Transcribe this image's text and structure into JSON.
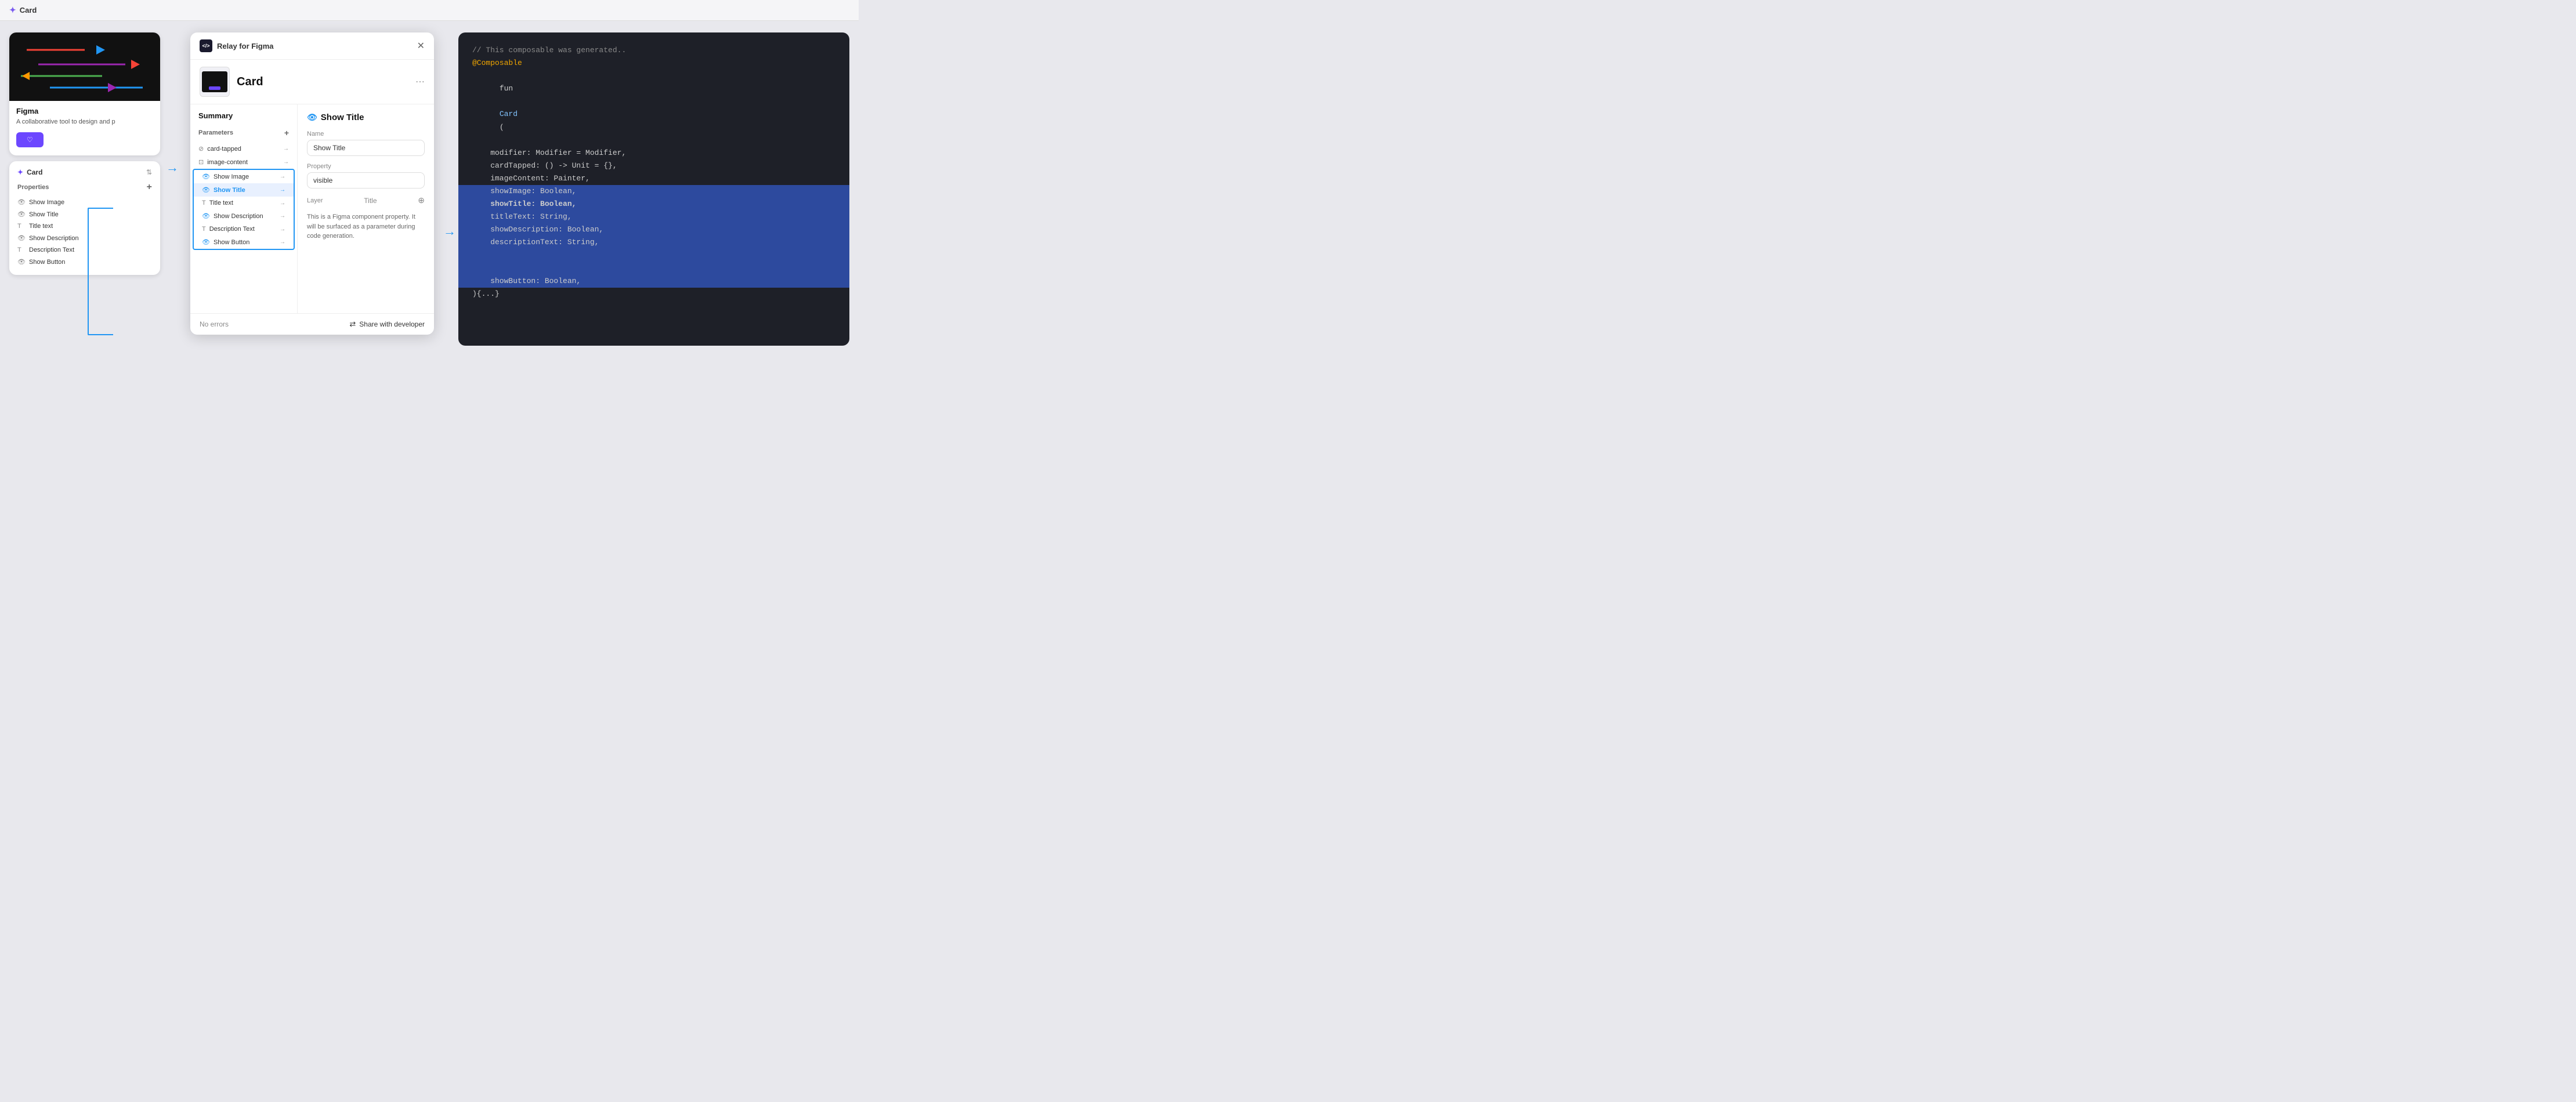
{
  "app": {
    "title": "Card",
    "logo_symbol": "✦"
  },
  "top_bar": {
    "title": "Card"
  },
  "left_panel": {
    "figma_source": "Figma",
    "figma_desc": "A collaborative tool to design and p",
    "panel_title": "Card",
    "properties_label": "Properties",
    "props": [
      {
        "icon": "eye",
        "label": "Show Image"
      },
      {
        "icon": "eye",
        "label": "Show Title"
      },
      {
        "icon": "text",
        "label": "Title text"
      },
      {
        "icon": "eye",
        "label": "Show Description"
      },
      {
        "icon": "text",
        "label": "Description Text"
      },
      {
        "icon": "eye",
        "label": "Show Button"
      }
    ]
  },
  "modal": {
    "plugin_name": "Relay for Figma",
    "component_name": "Card",
    "summary_title": "Summary",
    "params_label": "Parameters",
    "params": [
      {
        "icon": "link",
        "label": "card-tapped",
        "selected": false
      },
      {
        "icon": "image",
        "label": "image-content",
        "selected": false
      },
      {
        "icon": "eye",
        "label": "Show Image",
        "selected": false
      },
      {
        "icon": "eye",
        "label": "Show Title",
        "selected": true
      },
      {
        "icon": "text",
        "label": "Title text",
        "selected": false
      },
      {
        "icon": "eye",
        "label": "Show Description",
        "selected": false
      },
      {
        "icon": "text",
        "label": "Description Text",
        "selected": false
      },
      {
        "icon": "eye",
        "label": "Show Button",
        "selected": false
      }
    ],
    "detail": {
      "title": "Show Title",
      "name_label": "Name",
      "name_value": "Show Title",
      "property_label": "Property",
      "property_value": "visible",
      "layer_label": "Layer",
      "layer_value": "Title",
      "description": "This is a Figma component property. It will be surfaced as a parameter during code generation."
    },
    "footer": {
      "no_errors": "No errors",
      "share_label": "Share with developer"
    }
  },
  "code": {
    "comment": "// This composable was generated..",
    "annotation": "@Composable",
    "fun_keyword": "fun",
    "class_name": "Card",
    "lines": [
      {
        "text": "    modifier: Modifier = Modifier,",
        "highlight": false
      },
      {
        "text": "    cardTapped: () -> Unit = {},",
        "highlight": false
      },
      {
        "text": "    imageContent: Painter,",
        "highlight": false
      },
      {
        "text": "    showImage: Boolean,",
        "highlight": true
      },
      {
        "text": "    showTitle: Boolean,",
        "highlight": true
      },
      {
        "text": "    titleText: String,",
        "highlight": true
      },
      {
        "text": "    showDescription: Boolean,",
        "highlight": true
      },
      {
        "text": "    descriptionText: String,",
        "highlight": true
      },
      {
        "text": "    showButton: Boolean,",
        "highlight": true
      },
      {
        "text": "){...}",
        "highlight": false
      }
    ]
  }
}
